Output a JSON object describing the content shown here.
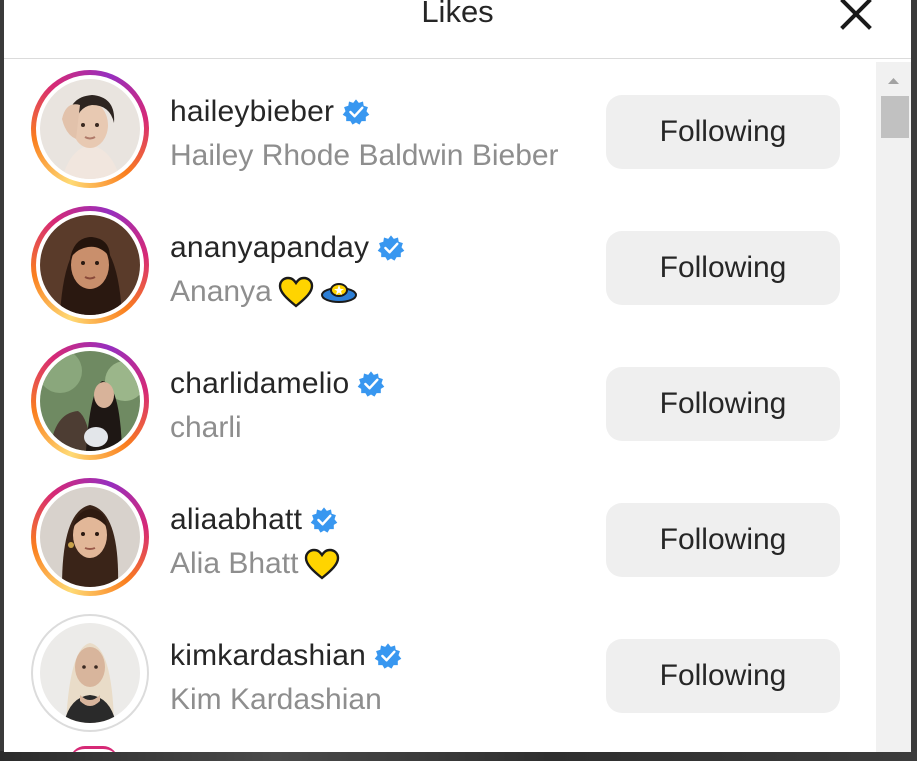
{
  "dialog": {
    "title": "Likes",
    "close_icon": "close-icon"
  },
  "users": [
    {
      "username": "haileybieber",
      "full_name": "Hailey Rhode Baldwin Bieber",
      "verified": true,
      "has_story": true,
      "emoji": [],
      "button_label": "Following"
    },
    {
      "username": "ananyapanday",
      "full_name": "Ananya",
      "verified": true,
      "has_story": true,
      "emoji": [
        "yellow-heart-icon",
        "ufo-icon"
      ],
      "button_label": "Following"
    },
    {
      "username": "charlidamelio",
      "full_name": "charli",
      "verified": true,
      "has_story": true,
      "emoji": [],
      "button_label": "Following"
    },
    {
      "username": "aliaabhatt",
      "full_name": "Alia Bhatt",
      "verified": true,
      "has_story": true,
      "emoji": [
        "yellow-heart-icon"
      ],
      "button_label": "Following"
    },
    {
      "username": "kimkardashian",
      "full_name": "Kim Kardashian",
      "verified": true,
      "has_story": false,
      "emoji": [],
      "button_label": "Following"
    }
  ],
  "colors": {
    "verified_badge": "#3897f0",
    "button_bg": "#efefef",
    "secondary_text": "#8e8e8e",
    "primary_text": "#262626",
    "story_ring": [
      "#feda75",
      "#fa7e1e",
      "#d62976",
      "#962fbf"
    ]
  }
}
